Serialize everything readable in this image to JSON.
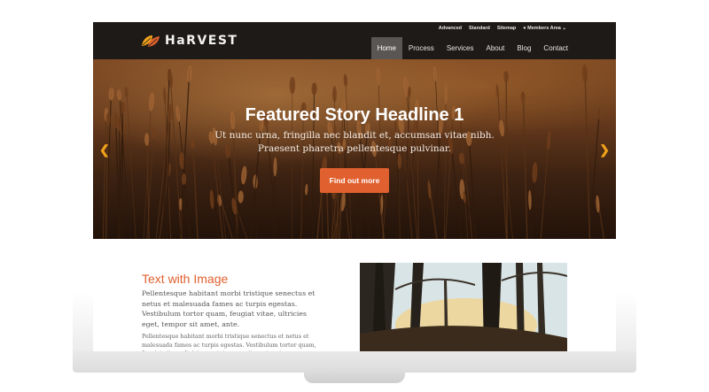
{
  "site": {
    "logo_text": "HaRVEST"
  },
  "util_nav": [
    "Advanced",
    "Standard",
    "Sitemap",
    "Members Area"
  ],
  "main_nav": [
    "Home",
    "Process",
    "Services",
    "About",
    "Blog",
    "Contact"
  ],
  "active_nav": "Home",
  "hero": {
    "title": "Featured Story Headline 1",
    "text_line1": "Ut nunc urna, fringilla nec blandit et, accumsan vitae nibh.",
    "text_line2": "Praesent pharetra pellentesque pulvinar.",
    "button": "Find out more"
  },
  "section": {
    "title": "Text with Image",
    "paragraph1": "Pellentesque habitant morbi tristique senectus et netus et malesuada fames ac turpis egestas. Vestibulum tortor quam, feugiat vitae, ultricies eget, tempor sit amet, ante.",
    "paragraph2": "Pellentesque habitant morbi tristique senectus et netus et malesuada fames ac turpis egestas. Vestibulum tortor quam, feugiat vitae, ultricies eget, tempor sit amet, ante."
  },
  "colors": {
    "header_bg": "#1e1a17",
    "accent": "#e0612f",
    "arrow": "#f0a21a"
  },
  "icons": {
    "logo": "leaf-icon",
    "members": "user-icon",
    "prev": "chevron-left-icon",
    "next": "chevron-right-icon"
  }
}
